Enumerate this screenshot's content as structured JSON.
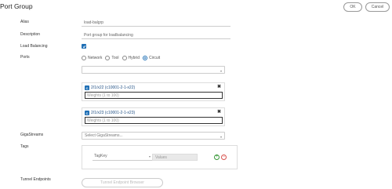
{
  "header": {
    "title": "Port Group",
    "ok_label": "OK",
    "cancel_label": "Cancel"
  },
  "form": {
    "alias": {
      "label": "Alias",
      "value": "load-balgrp"
    },
    "description": {
      "label": "Description",
      "value": "Port group for loadbalancing"
    },
    "load_balancing": {
      "label": "Load Balancing",
      "checked": true
    },
    "ports": {
      "label": "Ports",
      "radios": [
        {
          "label": "Network",
          "selected": false
        },
        {
          "label": "Tool",
          "selected": false
        },
        {
          "label": "Hybrid",
          "selected": false
        },
        {
          "label": "Circuit",
          "selected": true
        }
      ],
      "select_value": "",
      "items": [
        {
          "badge": "C",
          "name": "2/1/x22 (c10001-2-1-x22)",
          "weights_placeholder": "Weights (1 to 100)"
        },
        {
          "badge": "C",
          "name": "2/1/x23 (c10001-2-1-x23)",
          "weights_placeholder": "Weights (1 to 100)"
        }
      ]
    },
    "gigastreams": {
      "label": "GigaStreams",
      "placeholder": "Select GigaStreams..."
    },
    "tags": {
      "label": "Tags",
      "key_placeholder": "TagKey",
      "values_placeholder": "Values"
    },
    "tunnel": {
      "label": "Tunnel Endpoints",
      "button_label": "Tunnel Endpoint Browser"
    }
  },
  "colors": {
    "accent": "#1f6fb5",
    "add": "#3a9a3a",
    "remove": "#d9534f"
  }
}
